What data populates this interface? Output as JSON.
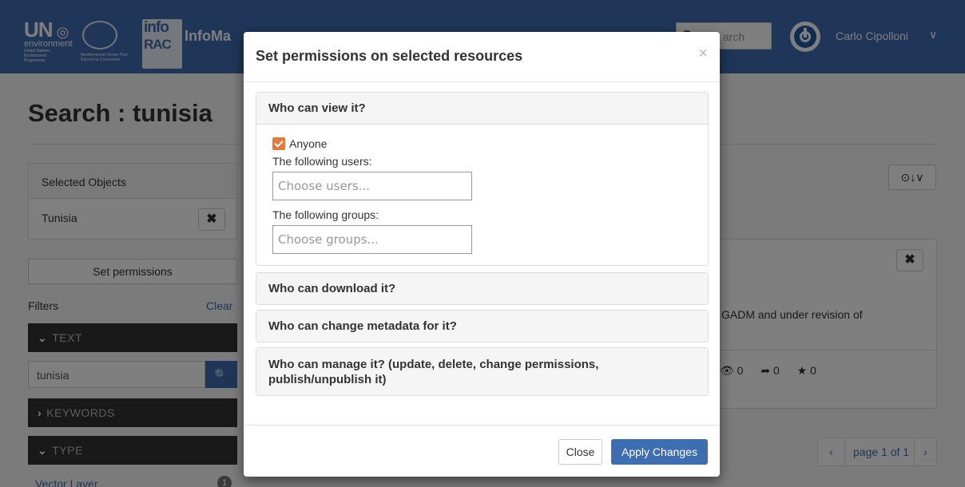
{
  "header": {
    "logo_un": "UN",
    "logo_env": "environment",
    "logo_un_small": "United Nations Environment Programme",
    "logo_seal_small": "Mediterranean Action Plan Barcelona Convention",
    "logo_info": "info",
    "logo_rac": "RAC",
    "brand_name": "InfoMa",
    "search_placeholder": "arch",
    "user_name": "Carlo Cipolloni",
    "user_caret": "∨"
  },
  "page": {
    "title": "Search : tunisia",
    "selected_objects_title": "Selected Objects",
    "selected_item": "Tunisia",
    "remove_icon": "✖",
    "set_permissions_label": "Set permissions",
    "filters_label": "Filters",
    "clear_label": "Clear",
    "filter_text_label": "TEXT",
    "text_value": "tunisia",
    "filter_keywords_label": "KEYWORDS",
    "filter_type_label": "TYPE",
    "vector_layer_label": "Vector Layer",
    "vector_layer_count": "1",
    "sort_label": "⊙↓∨",
    "result_description": "GADM and under revision of",
    "result_stats": [
      "👁 0",
      "➦ 0",
      "★ 0"
    ],
    "pager": {
      "prev": "‹",
      "label": "page 1 of 1",
      "next": "›"
    }
  },
  "modal": {
    "title": "Set permissions on selected resources",
    "close_x": "×",
    "sections": [
      {
        "title": "Who can view it?"
      },
      {
        "title": "Who can download it?"
      },
      {
        "title": "Who can change metadata for it?"
      },
      {
        "title": "Who can manage it? (update, delete, change permissions, publish/unpublish it)"
      }
    ],
    "view": {
      "anyone_label": "Anyone",
      "anyone_checked": true,
      "users_label": "The following users:",
      "users_placeholder": "Choose users...",
      "groups_label": "The following groups:",
      "groups_placeholder": "Choose groups..."
    },
    "footer": {
      "close_label": "Close",
      "apply_label": "Apply Changes"
    }
  },
  "colors": {
    "navbar": "#3f6db1",
    "checkbox": "#e07b39",
    "primary": "#3f6db1"
  }
}
